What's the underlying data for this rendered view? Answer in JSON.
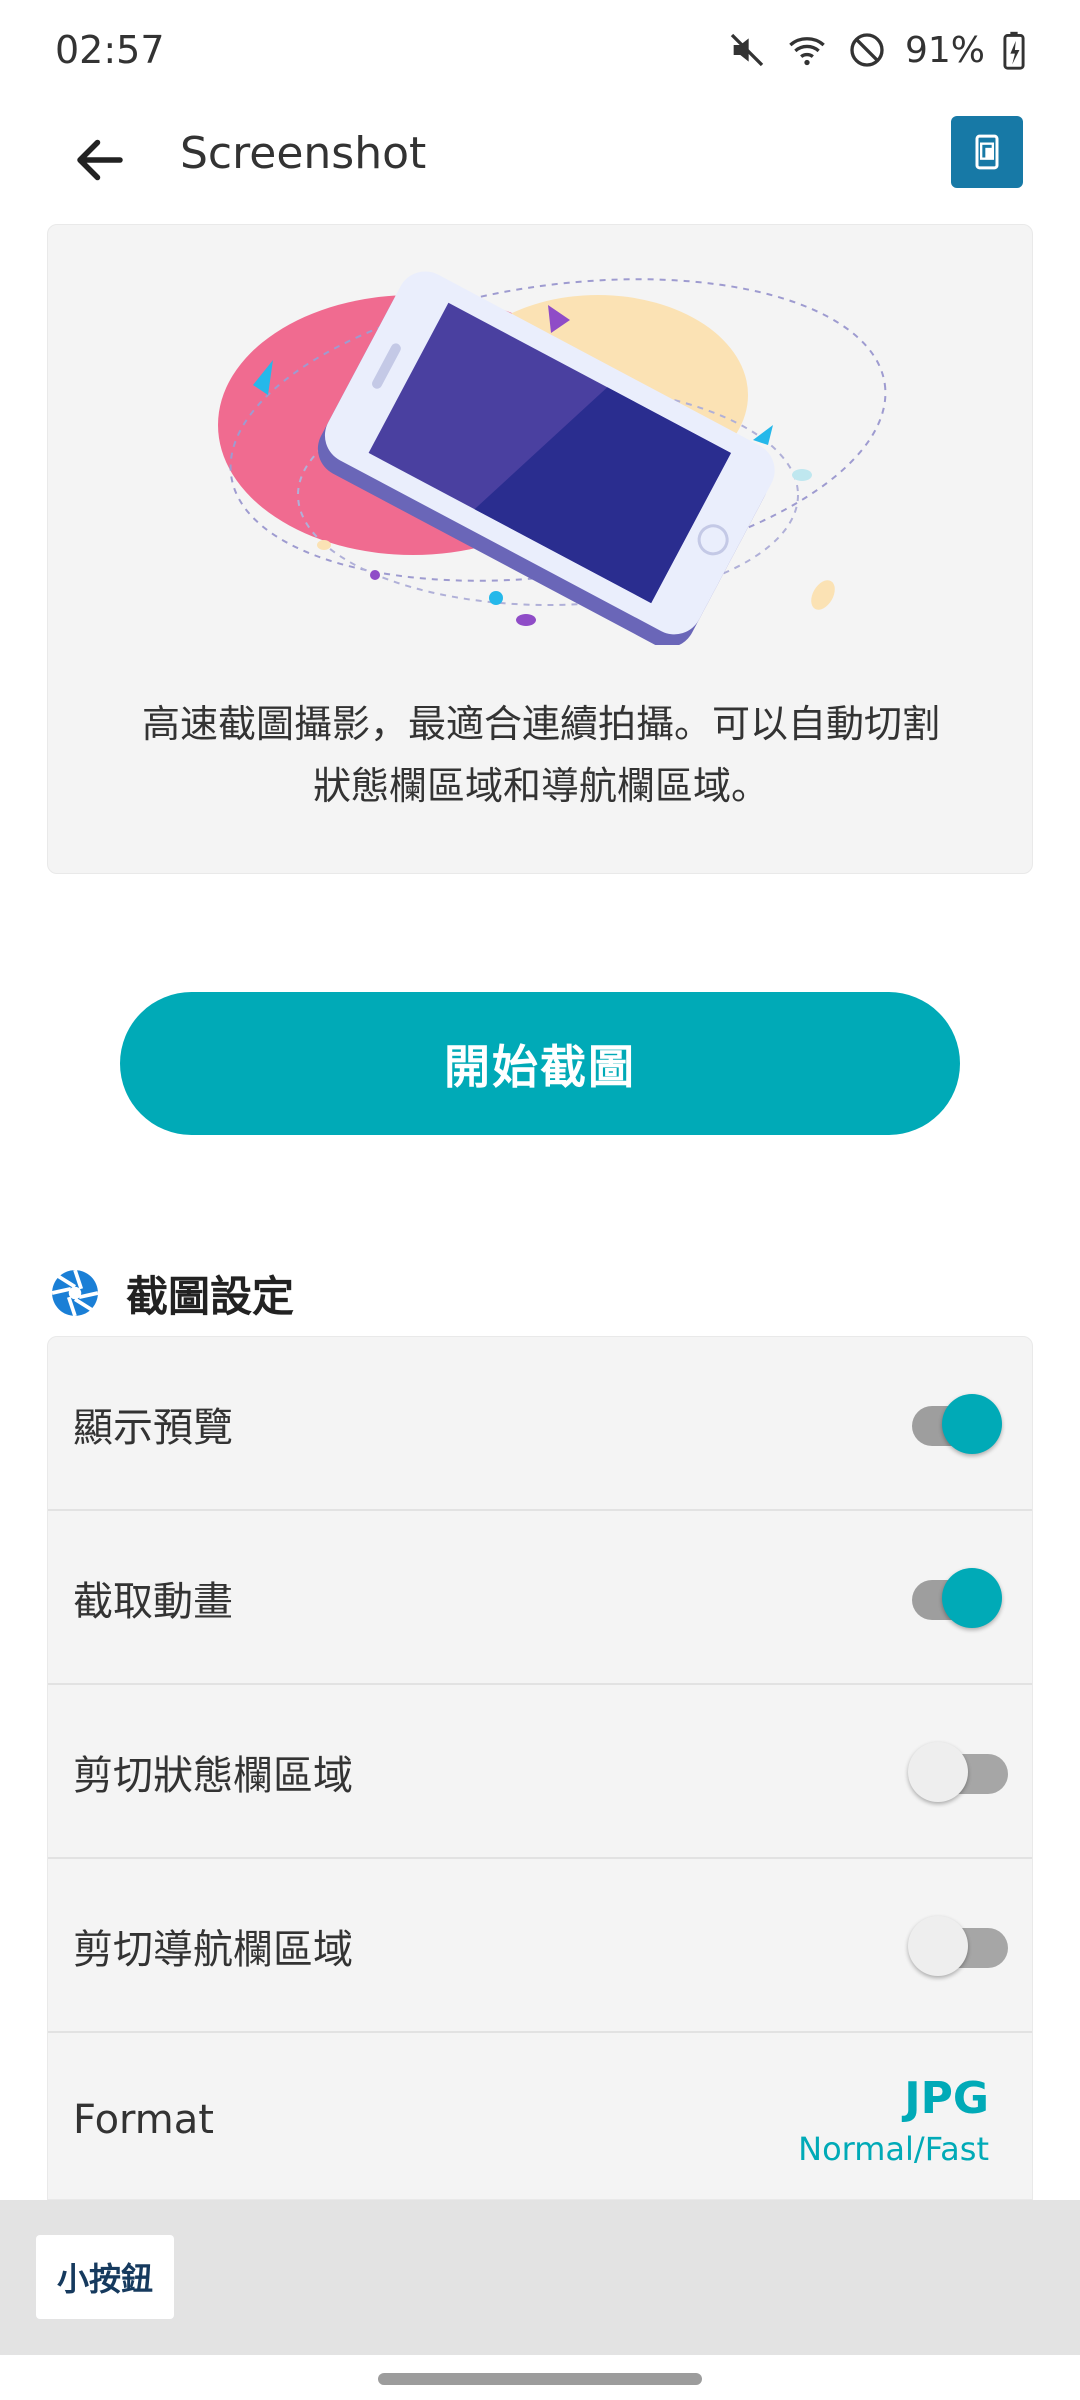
{
  "status_bar": {
    "time": "02:57",
    "battery": "91%",
    "icons": [
      "mute-icon",
      "wifi-icon",
      "do-not-disturb-icon",
      "battery-charging-icon"
    ]
  },
  "app_bar": {
    "title": "Screenshot",
    "back_icon": "arrow-left-icon",
    "action_icon": "phone-screenshot-icon",
    "action_color": "#1779a6"
  },
  "hero": {
    "description_line1": "高速截圖攝影，最適合連續拍攝。可以自動切割",
    "description_line2": "狀態欄區域和導航欄區域。"
  },
  "primary_action": {
    "label": "開始截圖",
    "color": "#00aab7"
  },
  "settings": {
    "section_title": "截圖設定",
    "section_icon": "aperture-icon",
    "items": [
      {
        "label": "顯示預覽",
        "enabled": true
      },
      {
        "label": "截取動畫",
        "enabled": true
      },
      {
        "label": "剪切狀態欄區域",
        "enabled": false
      },
      {
        "label": "剪切導航欄區域",
        "enabled": false
      }
    ],
    "format": {
      "label": "Format",
      "value": "JPG",
      "sub_value": "Normal/Fast"
    }
  },
  "bottom": {
    "small_button_label": "小按鈕"
  },
  "colors": {
    "accent": "#00aab7",
    "card_background": "#f4f4f4"
  }
}
